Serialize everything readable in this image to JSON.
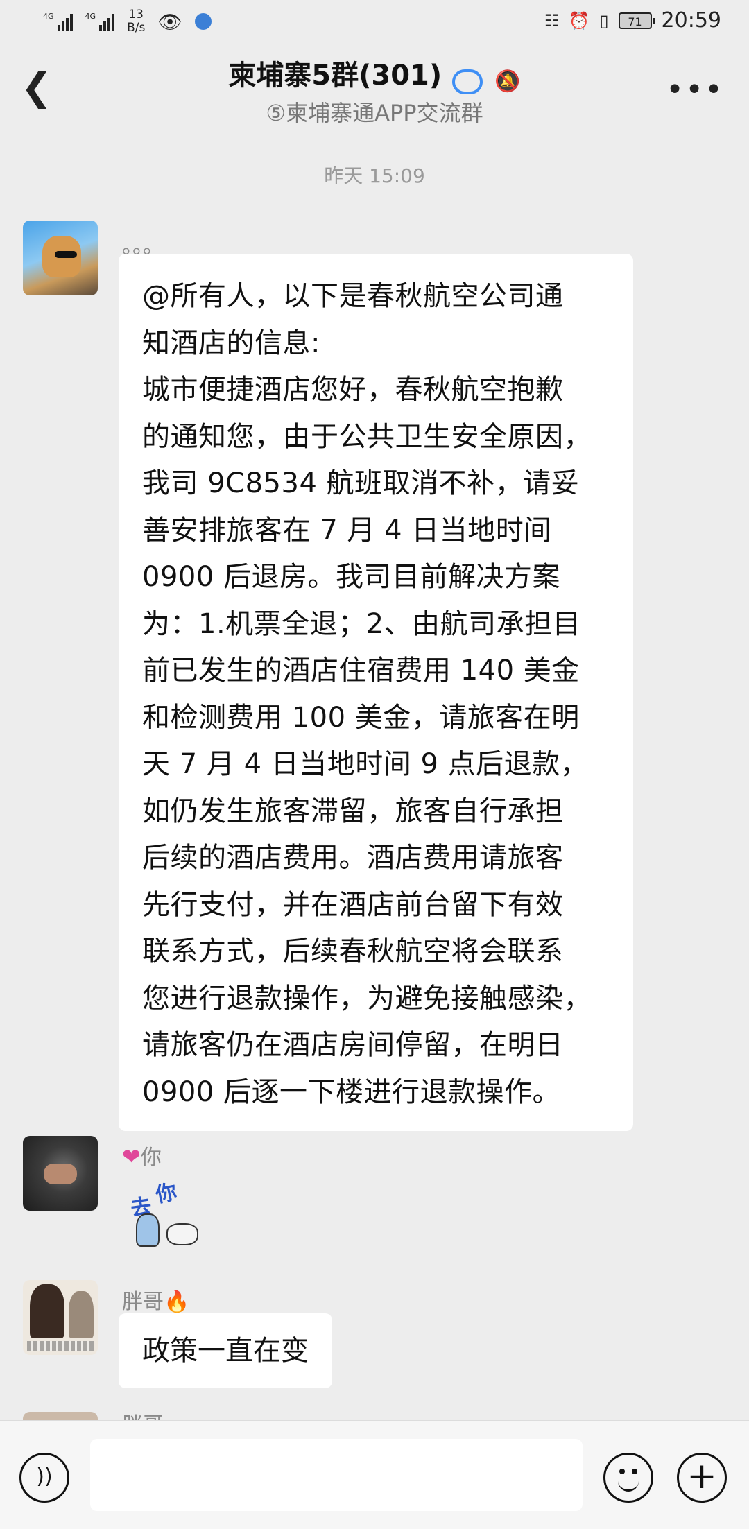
{
  "status_bar": {
    "sim1": "4G",
    "sim2": "4G",
    "speed_value": "13",
    "speed_unit": "B/s",
    "battery": "71",
    "time": "20:59"
  },
  "header": {
    "back_icon": "chevron-left-icon",
    "title": "柬埔寨5群(301)",
    "subtitle": "⑤柬埔寨通APP交流群",
    "more_icon": "more-dots-icon"
  },
  "chat": {
    "timestamp": "昨天 15:09",
    "messages": [
      {
        "sender": "。。。",
        "lines": [
          "@所有人，以下是春秋航空公司通",
          "知酒店的信息:",
          "城市便捷酒店您好，春秋航空抱歉",
          "的通知您，由于公共卫生安全原因，",
          "我司 9C8534 航班取消不补，请妥",
          "善安排旅客在 7 月 4 日当地时间",
          "0900 后退房。我司目前解决方案",
          "为：1.机票全退；2、由航司承担目",
          "前已发生的酒店住宿费用 140 美金",
          "和检测费用 100 美金，请旅客在明",
          "天 7 月 4 日当地时间 9 点后退款，",
          "如仍发生旅客滞留，旅客自行承担",
          "后续的酒店费用。酒店费用请旅客",
          "先行支付，并在酒店前台留下有效",
          "联系方式，后续春秋航空将会联系",
          "您进行退款操作，为避免接触感染，",
          "请旅客仍在酒店房间停留，在明日",
          "0900 后逐一下楼进行退款操作。"
        ]
      },
      {
        "sender": "你",
        "sticker_text_1": "你",
        "sticker_text_2": "去"
      },
      {
        "sender": "胖哥",
        "text": "政策一直在变"
      },
      {
        "sender": "胖哥"
      }
    ]
  },
  "input_bar": {
    "voice_icon": "voice-icon",
    "emoji_icon": "emoji-icon",
    "plus_icon": "plus-icon",
    "placeholder": ""
  },
  "colors": {
    "background": "#ededed",
    "bubble": "#ffffff",
    "verify_badge": "#3f8ff5",
    "heart": "#e0489a",
    "fire": "#f07a1f"
  }
}
